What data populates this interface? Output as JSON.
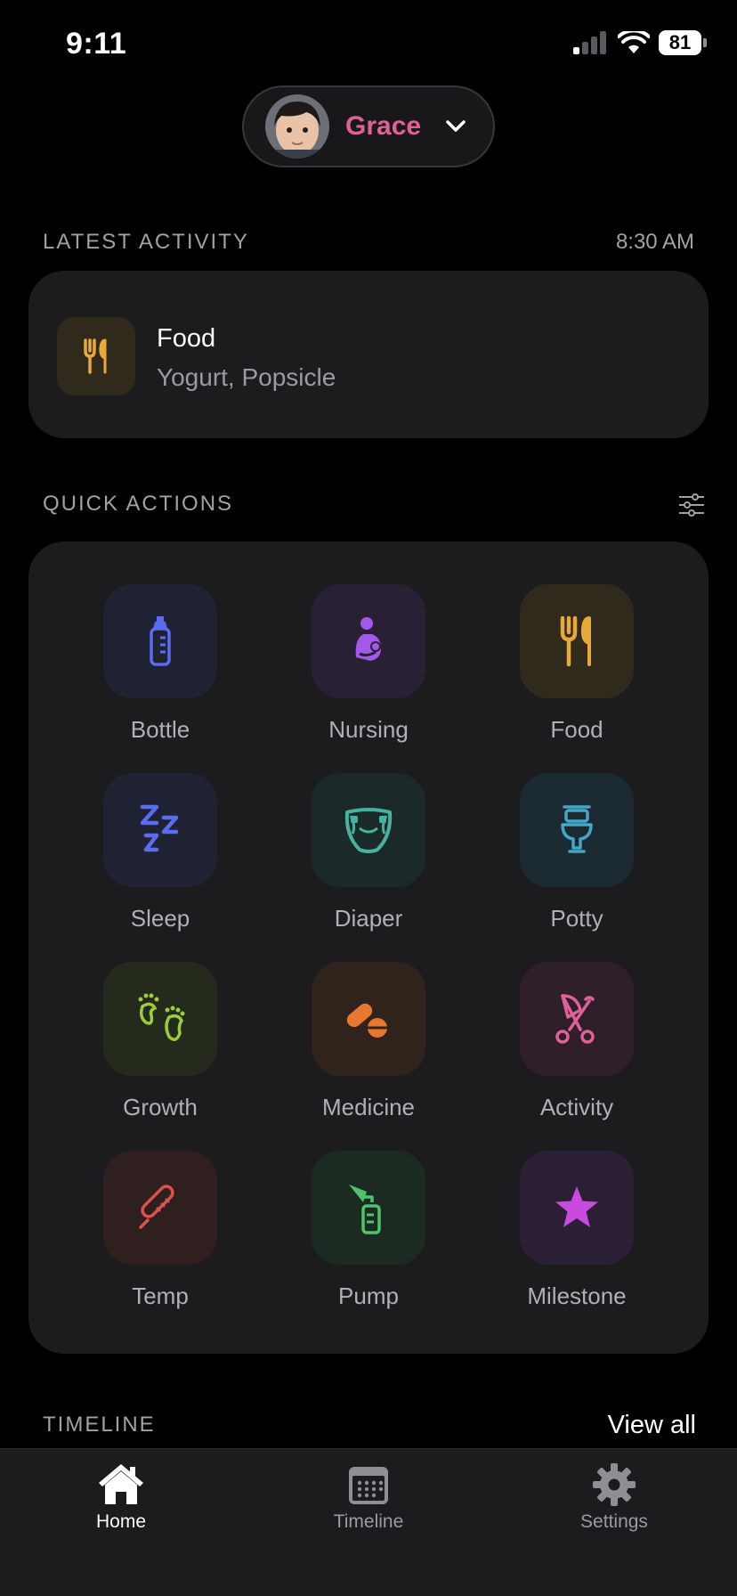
{
  "status_bar": {
    "time": "9:11",
    "battery": "81"
  },
  "child": {
    "name": "Grace",
    "name_color": "#e0609a"
  },
  "latest_activity": {
    "header": "LATEST ACTIVITY",
    "time": "8:30 AM",
    "title": "Food",
    "subtitle": "Yogurt, Popsicle",
    "icon": "fork-knife-icon"
  },
  "quick_actions": {
    "header": "QUICK ACTIONS",
    "items": [
      {
        "label": "Bottle",
        "icon": "bottle-icon",
        "color": "#5b6cf0",
        "bg": "#1f2233"
      },
      {
        "label": "Nursing",
        "icon": "nursing-icon",
        "color": "#a258e8",
        "bg": "#2a2035"
      },
      {
        "label": "Food",
        "icon": "fork-knife-icon",
        "color": "#e8a93a",
        "bg": "#2f2a1c"
      },
      {
        "label": "Sleep",
        "icon": "sleep-icon",
        "color": "#5b6cf0",
        "bg": "#1f2233"
      },
      {
        "label": "Diaper",
        "icon": "diaper-icon",
        "color": "#45b3a0",
        "bg": "#1b2a28"
      },
      {
        "label": "Potty",
        "icon": "potty-icon",
        "color": "#46a6c8",
        "bg": "#1b2a30"
      },
      {
        "label": "Growth",
        "icon": "footprints-icon",
        "color": "#9ccc3a",
        "bg": "#242b1c"
      },
      {
        "label": "Medicine",
        "icon": "pills-icon",
        "color": "#e8782f",
        "bg": "#2f231c"
      },
      {
        "label": "Activity",
        "icon": "stroller-icon",
        "color": "#e0609a",
        "bg": "#2f1f29"
      },
      {
        "label": "Temp",
        "icon": "thermometer-icon",
        "color": "#e0504a",
        "bg": "#2f1f1f"
      },
      {
        "label": "Pump",
        "icon": "breast-pump-icon",
        "color": "#4fc26a",
        "bg": "#1c2b21"
      },
      {
        "label": "Milestone",
        "icon": "star-icon",
        "color": "#c94ae0",
        "bg": "#2a1f35"
      }
    ]
  },
  "timeline": {
    "header": "TIMELINE",
    "view_all": "View all"
  },
  "tab_bar": {
    "tabs": [
      {
        "label": "Home",
        "icon": "home-icon",
        "active": true
      },
      {
        "label": "Timeline",
        "icon": "calendar-icon",
        "active": false
      },
      {
        "label": "Settings",
        "icon": "gear-icon",
        "active": false
      }
    ]
  }
}
